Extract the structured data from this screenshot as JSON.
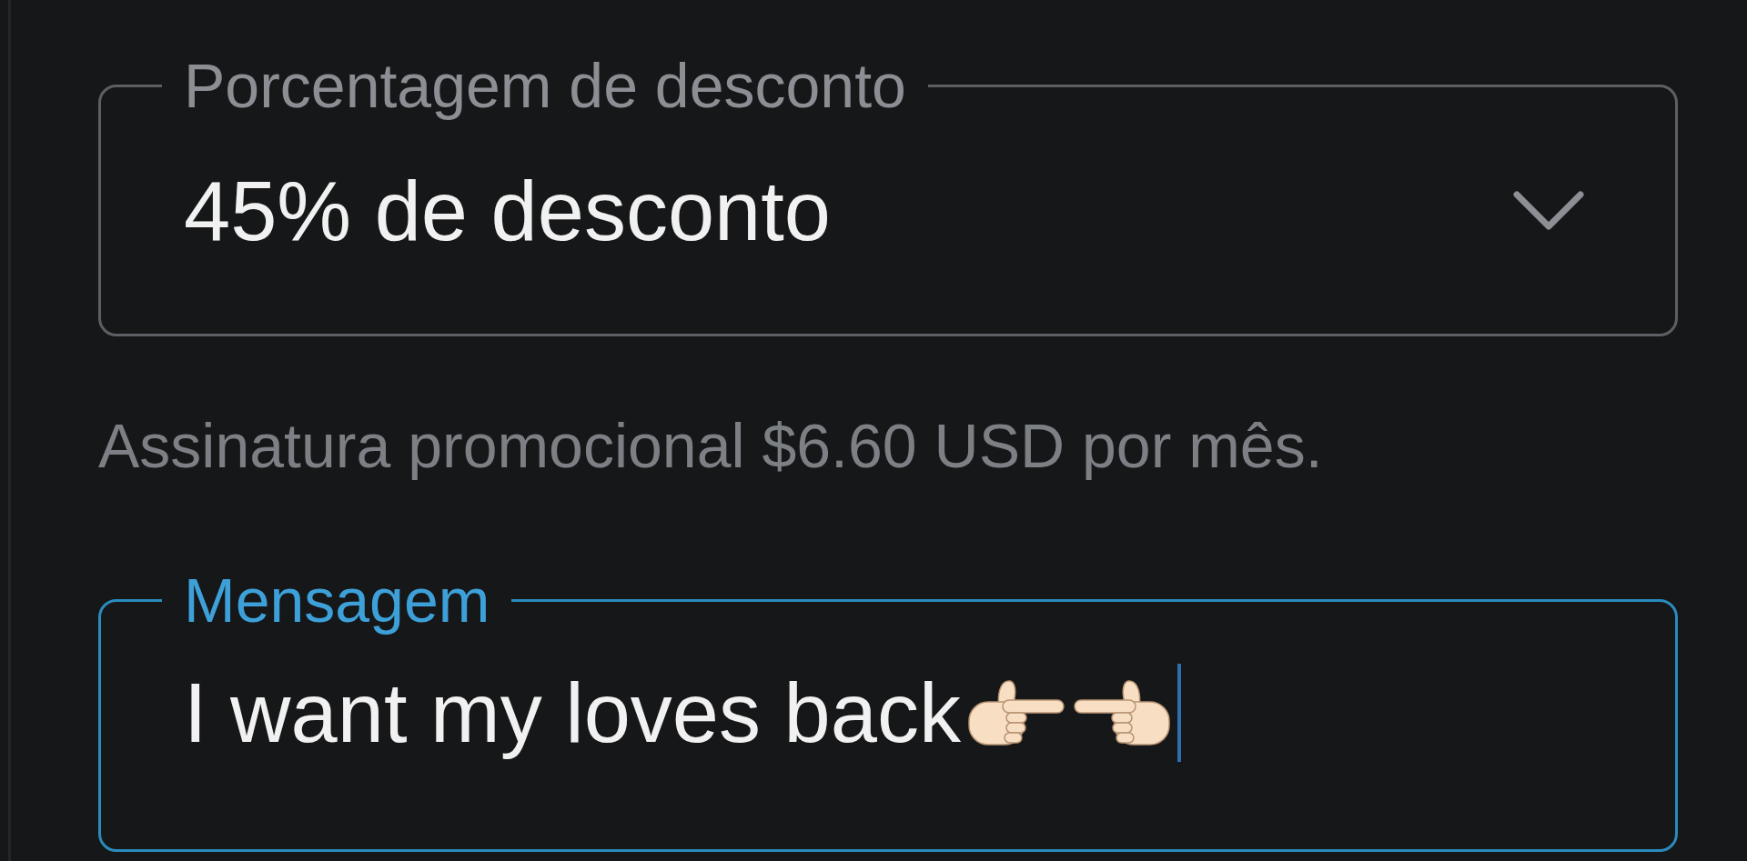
{
  "fields": [
    {
      "kind": "select",
      "label": "Porcentagem de desconto",
      "value": "45% de desconto",
      "focused": false,
      "helper_text": "Assinatura promocional $6.60 USD por mês."
    },
    {
      "kind": "text",
      "label": "Mensagem",
      "value": "I want my loves back",
      "focused": true
    }
  ]
}
